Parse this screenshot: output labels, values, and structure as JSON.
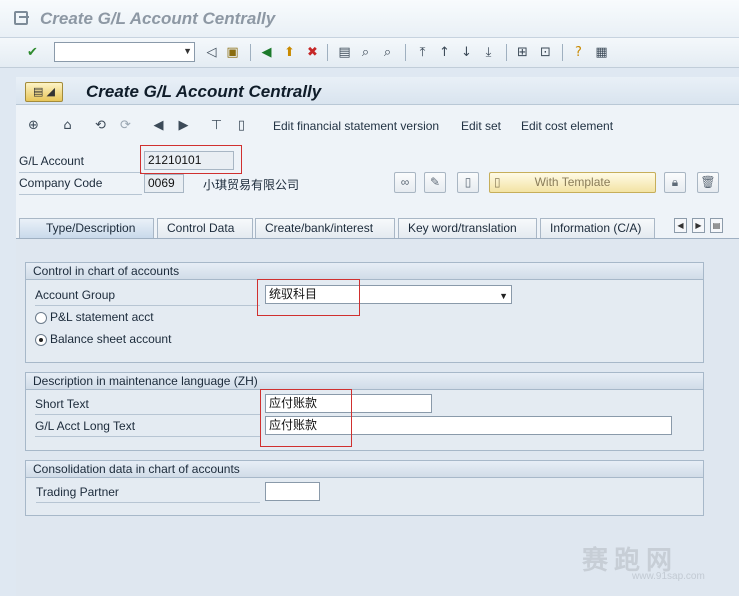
{
  "window": {
    "title": "Create G/L Account Centrally"
  },
  "screen": {
    "title": "Create G/L Account Centrally"
  },
  "app_toolbar": {
    "edit_fs_version": "Edit financial statement version",
    "edit_set": "Edit set",
    "edit_cost_element": "Edit cost element"
  },
  "header": {
    "gl_account_label": "G/L Account",
    "gl_account_value": "21210101",
    "company_code_label": "Company Code",
    "company_code_value": "0069",
    "company_name": "小琪贸易有限公司",
    "with_template_label": "With Template"
  },
  "tabs": [
    {
      "label": "Type/Description"
    },
    {
      "label": "Control Data"
    },
    {
      "label": "Create/bank/interest"
    },
    {
      "label": "Key word/translation"
    },
    {
      "label": "Information (C/A)"
    }
  ],
  "group_control": {
    "title": "Control in chart of accounts",
    "account_group_label": "Account Group",
    "account_group_value": "统驭科目",
    "pl_label": "P&L statement acct",
    "bs_label": "Balance sheet account",
    "selected": "Balance sheet account"
  },
  "group_description": {
    "title": "Description in maintenance language (ZH)",
    "short_text_label": "Short Text",
    "short_text_value": "应付账款",
    "long_text_label": "G/L Acct Long Text",
    "long_text_value": "应付账款"
  },
  "group_consolidation": {
    "title": "Consolidation data in chart of accounts",
    "trading_partner_label": "Trading Partner",
    "trading_partner_value": ""
  },
  "watermark": {
    "text": "赛跑网",
    "url": "www.91sap.com"
  },
  "colors": {
    "highlight": "#d0302f",
    "title_text": "#0f1c29"
  }
}
